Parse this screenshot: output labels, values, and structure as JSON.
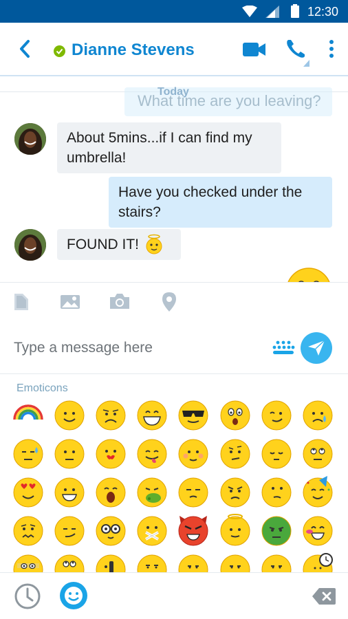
{
  "status_bar": {
    "time": "12:30"
  },
  "header": {
    "contact_name": "Dianne Stevens",
    "presence": "online"
  },
  "chat": {
    "ghost_message": "What time are you leaving?",
    "day_label": "Today",
    "messages": [
      {
        "direction": "incoming",
        "text": "About 5mins...if I can find my umbrella!"
      },
      {
        "direction": "outgoing",
        "text": "Have you checked under the stairs?"
      },
      {
        "direction": "incoming",
        "text": "FOUND IT!",
        "emoticon": "angel-emoticon"
      }
    ]
  },
  "toolbar": {
    "tools": [
      "file-icon",
      "photo-icon",
      "camera-icon",
      "location-icon"
    ]
  },
  "compose": {
    "placeholder": "Type a message here",
    "value": ""
  },
  "emoticons": {
    "title": "Emoticons",
    "rows": [
      [
        "rainbow",
        "smile",
        "sad",
        "laugh",
        "cool",
        "surprised",
        "wink",
        "cry"
      ],
      [
        "sweat",
        "speechless",
        "kiss",
        "tongue-out",
        "blush",
        "wondering",
        "sleepy",
        "eye-roll"
      ],
      [
        "in-love",
        "grin",
        "yawn",
        "puke",
        "doh",
        "angry",
        "thinking",
        "party"
      ],
      [
        "worried",
        "smirk",
        "nerd",
        "lips-sealed",
        "devil",
        "angel",
        "envy",
        "wait"
      ],
      [
        "bandit",
        "pensive",
        "hmm",
        "dull",
        "blank",
        "blank",
        "blank",
        "clock-face"
      ]
    ]
  },
  "colors": {
    "brand_blue": "#0f86d1",
    "status_bar": "#00589c",
    "accent": "#39b5ef",
    "emoji_yellow": "#ffd21c"
  }
}
